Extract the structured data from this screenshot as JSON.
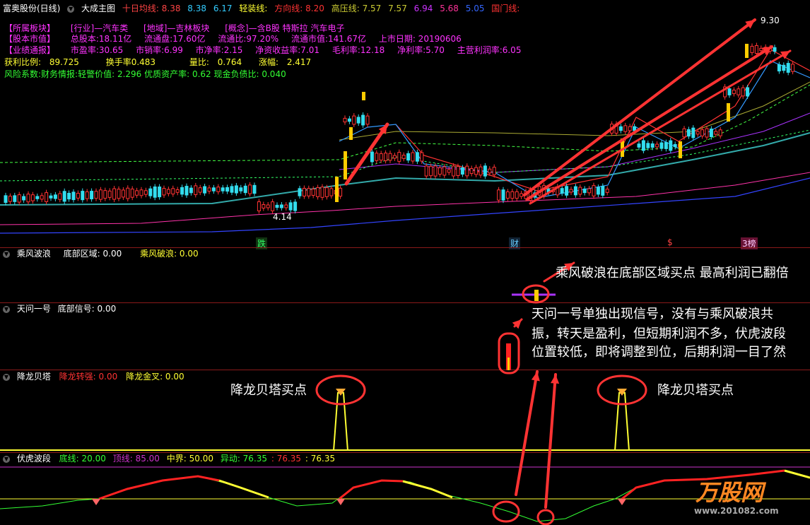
{
  "main_panel": {
    "stock": "富奥股份(日线)",
    "indicator": "大成主图",
    "ma10_label": "十日均线:",
    "ma10_value": "8.38",
    "v1": "8.38",
    "v2": "6.17",
    "light_label": "轻装线:",
    "dir_label": "方向线:",
    "dir_value": "8.20",
    "pressure_label": "高压线:",
    "pressure_v1": "7.57",
    "pressure_v2": "7.57",
    "v3": "6.94",
    "v4": "5.68",
    "v5": "5.05",
    "gate_label": "国门线:"
  },
  "info": {
    "row1": [
      "【所属板块】",
      "[行业]—汽车类",
      "[地域]—吉林板块",
      "[概念]—含B股 特斯拉 汽车电子"
    ],
    "row2": [
      "【股本市值】",
      "总股本:18.11亿",
      "流通盘:17.60亿",
      "流通比:97.20%",
      "流通市值:141.67亿",
      "上市日期: 20190606"
    ],
    "row3": [
      "【业绩通报】",
      "市盈率:30.65",
      "市销率:6.99",
      "市净率:2.15",
      "净资收益率:7.01",
      "毛利率:12.18",
      "净利率:5.70",
      "主营利润率:6.05"
    ],
    "row4": [
      "获利比例:",
      "89.725",
      "换手率0.483",
      "量比:",
      "0.764",
      "涨幅:",
      "2.417"
    ],
    "row5": "风险系数:财务情报:轻警价值: 2.296 优质资产率: 0.62 现金负债比: 0.040"
  },
  "chart_marks": {
    "high": "9.30",
    "low": "4.14",
    "bottom_labels": [
      "跌",
      "财",
      "$",
      "3榜"
    ]
  },
  "panel2": {
    "name": "乘风波浪",
    "l1": "底部区域: 0.00",
    "l2": "乘风破浪: 0.00"
  },
  "panel3": {
    "name": "天问一号",
    "l1": "底部信号: 0.00"
  },
  "panel4": {
    "name": "降龙贝塔",
    "l1": "降龙转强: 0.00",
    "l2": "降龙金叉: 0.00"
  },
  "panel5": {
    "name": "伏虎波段",
    "l1": "底线: 20.00",
    "l2": "顶线: 85.00",
    "l3": "中界: 50.00",
    "l4": "异动: 76.35",
    "l5": ": 76.35",
    "l6": ": 76.35"
  },
  "annotations": {
    "a1": "乘风破浪在底部区域买点 最高利润已翻倍",
    "a2_line1": "天问一号单独出现信号，没有与乘风破浪共",
    "a2_line2": "振，转天是盈利，但短期利润不多，伏虎波段",
    "a2_line3": "位置较低，即将调整到位，后期利润一目了然",
    "a3": "降龙贝塔买点",
    "a4": "降龙贝塔买点"
  },
  "watermark": {
    "brand": "万股网",
    "url": "www.201082.com"
  },
  "colors": {
    "up": "#ff3333",
    "down": "#33ddee",
    "yellow": "#ffff33",
    "magenta": "#cc33cc",
    "arrow": "#ff3333"
  }
}
